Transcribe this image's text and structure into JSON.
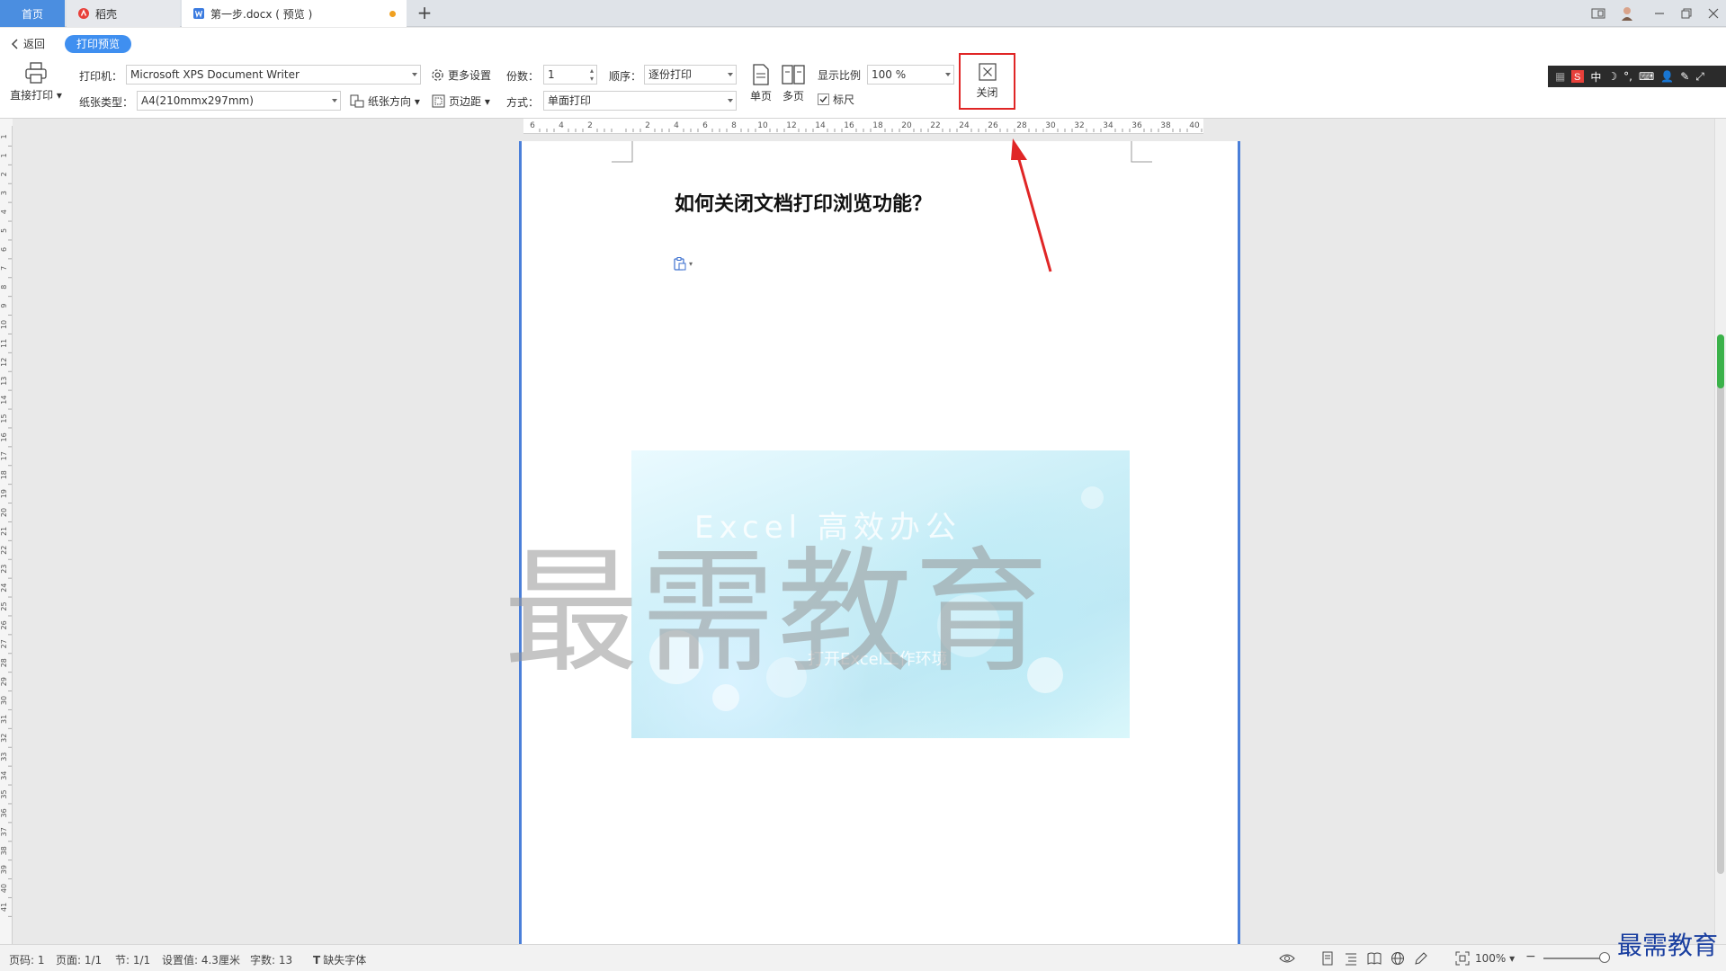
{
  "titlebar": {
    "tab_home": "首页",
    "tab_shell": "稻壳",
    "tab_doc": "第一步.docx ( 预览 )",
    "new_tab": "+"
  },
  "toolbar": {
    "back": "返回",
    "print_preview": "打印预览",
    "direct_print": "直接打印",
    "printer_label": "打印机：",
    "printer_value": "Microsoft XPS Document Writer",
    "paper_label": "纸张类型：",
    "paper_value": "A4(210mmx297mm)",
    "more_settings": "更多设置",
    "orientation": "纸张方向",
    "margins": "页边距",
    "copies_label": "份数：",
    "copies_value": "1",
    "order_label": "顺序：",
    "order_value": "逐份打印",
    "mode_label": "方式：",
    "mode_value": "单面打印",
    "single_page": "单页",
    "multi_page": "多页",
    "zoom_label": "显示比例",
    "zoom_value": "100 %",
    "ruler_label": "标尺",
    "close": "关闭"
  },
  "ime": {
    "mode": "中"
  },
  "ruler": {
    "h_ticks": [
      "6",
      "4",
      "2",
      "",
      "2",
      "4",
      "6",
      "8",
      "10",
      "12",
      "14",
      "16",
      "18",
      "20",
      "22",
      "24",
      "26",
      "28",
      "30",
      "32",
      "34",
      "36",
      "38",
      "40"
    ],
    "v_ticks": [
      "1",
      "1",
      "2",
      "3",
      "4",
      "5",
      "6",
      "7",
      "8",
      "9",
      "10",
      "11",
      "12",
      "13",
      "14",
      "15",
      "16",
      "17",
      "18",
      "19",
      "20",
      "21",
      "22",
      "23",
      "24",
      "25",
      "26",
      "27",
      "28",
      "29",
      "30",
      "31",
      "32",
      "33",
      "34",
      "35",
      "36",
      "37",
      "38",
      "39",
      "40",
      "41"
    ]
  },
  "document": {
    "title": "如何关闭文档打印浏览功能？",
    "image_heading": "Excel 高效办公",
    "image_caption": "打开Excel工作环境"
  },
  "watermark": "最需教育",
  "statusbar": {
    "page_num": "页码: 1",
    "pages": "页面: 1/1",
    "section": "节: 1/1",
    "setting": "设置值: 4.3厘米",
    "words": "字数: 13",
    "missing_font": "缺失字体",
    "zoom": "100%"
  },
  "brand": "最需教育",
  "colors": {
    "accent": "#3f8ff0",
    "highlight": "#e02626",
    "page_border": "#4a7fd9"
  }
}
